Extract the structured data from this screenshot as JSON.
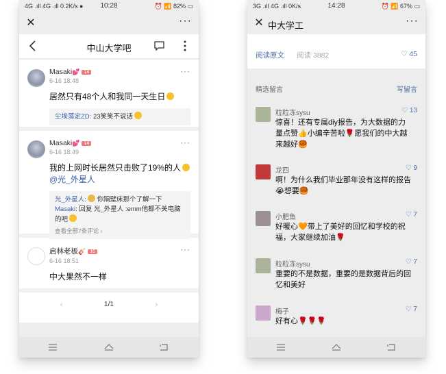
{
  "left": {
    "status": {
      "left": "4G .ıll 4G .ıll 0.2K/s ●",
      "time": "10:28",
      "right": "⏰ 📶 82% ▭"
    },
    "titlebar": {
      "close_label": "✕",
      "more_label": "···"
    },
    "navbar": {
      "title": "中山大学吧"
    },
    "posts": [
      {
        "user": "Masaki",
        "level": "14",
        "time": "6-16 18:48",
        "text": "居然只有48个人和我同一天生日",
        "reply": {
          "name": "尘埃落定ZD:",
          "text": "23笑笑不说话"
        }
      },
      {
        "user": "Masaki",
        "level": "14",
        "time": "6-16 18:49",
        "text": "我的上网时长居然只击败了19%的人",
        "mention": "@光_外星人",
        "replies": [
          {
            "name": "光_外星人:",
            "text": "你隔壁床那个了解一下"
          },
          {
            "name": "Masaki",
            "text": ": 回复 光_外星人 :emm他都不关电脑的吧"
          }
        ],
        "view_all": "查看全部7条评论 ›"
      },
      {
        "user": "启林老板",
        "level": "10",
        "time": "6-16 18:51",
        "text": "中大果然不一样"
      }
    ],
    "pager": {
      "current": "1/1",
      "prev": "‹",
      "next": "›"
    }
  },
  "right": {
    "status": {
      "left": "3G .ıll 4G .ıll 0K/s",
      "time": "14:28",
      "right": "⏰ 📶 67% ▭"
    },
    "titlebar": {
      "title": "中大学工",
      "close_label": "✕",
      "more_label": "···"
    },
    "article": {
      "read_original": "阅读原文",
      "read_count": "阅读 3882",
      "likes": "♡ 45"
    },
    "section_title": "精选留言",
    "write_label": "写留言",
    "comments": [
      {
        "name": "粒粒冻sysu",
        "likes": "♡ 13",
        "text": "惊喜！还有专属diy报告，为大数据的力量点赞👍小编辛苦啦🌹愿我们的中大越来越好🥮",
        "avatar_color": "#a8b39a"
      },
      {
        "name": "龙四",
        "likes": "♡ 9",
        "text": "啊！为什么我们毕业那年没有这样的报告😭想要🥮",
        "avatar_color": "#c0393b"
      },
      {
        "name": "小肥鱼",
        "likes": "♡ 7",
        "text": "好暖心🧡带上了美好的回忆和学校的祝福，大家继续加油🌹",
        "avatar_color": "#9b8f95"
      },
      {
        "name": "粒粒冻sysu",
        "likes": "♡ 7",
        "text": "重要的不是数据，重要的是数据背后的回忆和美好",
        "avatar_color": "#a8b39a"
      },
      {
        "name": "梅子",
        "likes": "♡ 7",
        "text": "好有心🌹🌹🌹",
        "avatar_color": "#c9a8c9"
      }
    ]
  }
}
